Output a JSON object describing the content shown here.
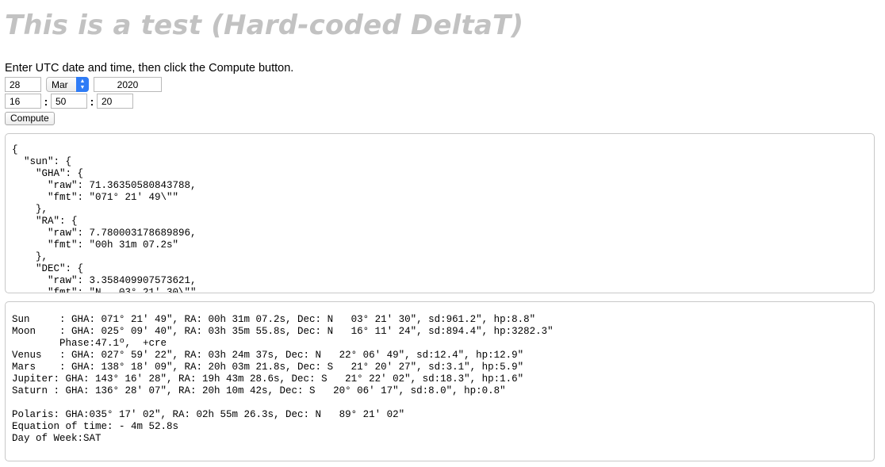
{
  "page": {
    "title": "This is a test (Hard-coded DeltaT)",
    "instructions": "Enter UTC date and time, then click the Compute button."
  },
  "date_inputs": {
    "day": "28",
    "month": "Mar",
    "year": "2020"
  },
  "time_inputs": {
    "hour": "16",
    "minute": "50",
    "second": "20",
    "separator": ":"
  },
  "compute_button": {
    "label": "Compute"
  },
  "json_output": {
    "text": "{\n  \"sun\": {\n    \"GHA\": {\n      \"raw\": 71.36350580843788,\n      \"fmt\": \"071° 21' 49\\\"\"\n    },\n    \"RA\": {\n      \"raw\": 7.780003178689896,\n      \"fmt\": \"00h 31m 07.2s\"\n    },\n    \"DEC\": {\n      \"raw\": 3.358409907573621,\n      \"fmt\": \"N   03° 21' 30\\\"\""
  },
  "summary_output": {
    "text": "Sun     : GHA: 071° 21' 49\", RA: 00h 31m 07.2s, Dec: N   03° 21' 30\", sd:961.2\", hp:8.8\"\nMoon    : GHA: 025° 09' 40\", RA: 03h 35m 55.8s, Dec: N   16° 11' 24\", sd:894.4\", hp:3282.3\"\n        Phase:47.1º,  +cre\nVenus   : GHA: 027° 59' 22\", RA: 03h 24m 37s, Dec: N   22° 06' 49\", sd:12.4\", hp:12.9\"\nMars    : GHA: 138° 18' 09\", RA: 20h 03m 21.8s, Dec: S   21° 20' 27\", sd:3.1\", hp:5.9\"\nJupiter: GHA: 143° 16' 28\", RA: 19h 43m 28.6s, Dec: S   21° 22' 02\", sd:18.3\", hp:1.6\"\nSaturn : GHA: 136° 28' 07\", RA: 20h 10m 42s, Dec: S   20° 06' 17\", sd:8.0\", hp:0.8\"\n\nPolaris: GHA:035° 17' 02\", RA: 02h 55m 26.3s, Dec: N   89° 21' 02\"\nEquation of time: - 4m 52.8s\nDay of Week:SAT"
  }
}
